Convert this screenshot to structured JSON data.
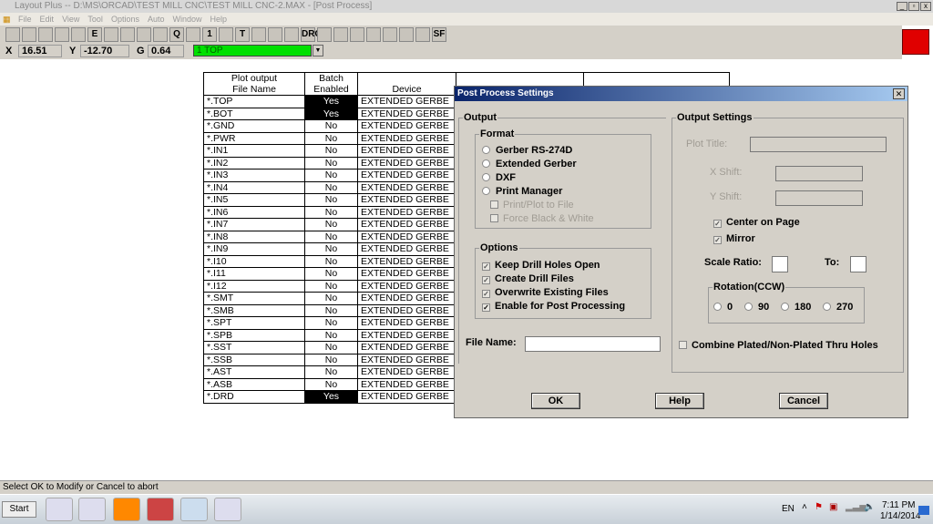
{
  "window": {
    "title": "Layout Plus -- D:\\MS\\ORCAD\\TEST MILL CNC\\TEST MILL CNC-2.MAX - [Post Process]"
  },
  "menu": [
    "File",
    "Edit",
    "View",
    "Tool",
    "Options",
    "Auto",
    "Window",
    "Help"
  ],
  "toolbar": {
    "buttons": [
      "open",
      "save",
      "stack",
      "x",
      "binoculars",
      "E",
      "grid",
      "zoom-in",
      "zoom-out",
      "zoom-window",
      "Q",
      "pad",
      "1",
      "color",
      "T",
      "route",
      "null",
      "colors",
      "DRC",
      "block",
      "swap",
      "pin",
      "gate",
      "auto",
      "error",
      "drc-check",
      "SF"
    ]
  },
  "coords": {
    "x_label": "X",
    "x": "16.51",
    "y_label": "Y",
    "y": "-12.70",
    "g_label": "G",
    "g": "0.64",
    "layer": "1 TOP"
  },
  "accent": {
    "layer_green": "#00e000",
    "red_indicator": "#e00000"
  },
  "table": {
    "headers": [
      "Plot output\nFile Name",
      "Batch\nEnabled",
      "Device"
    ],
    "header1": [
      "Plot output",
      "Batch",
      ""
    ],
    "header2": [
      "File Name",
      "Enabled",
      "Device"
    ],
    "rows": [
      [
        "*.TOP",
        "Yes",
        "EXTENDED GERBE"
      ],
      [
        "*.BOT",
        "Yes",
        "EXTENDED GERBE"
      ],
      [
        "*.GND",
        "No",
        "EXTENDED GERBE"
      ],
      [
        "*.PWR",
        "No",
        "EXTENDED GERBE"
      ],
      [
        "*.IN1",
        "No",
        "EXTENDED GERBE"
      ],
      [
        "*.IN2",
        "No",
        "EXTENDED GERBE"
      ],
      [
        "*.IN3",
        "No",
        "EXTENDED GERBE"
      ],
      [
        "*.IN4",
        "No",
        "EXTENDED GERBE"
      ],
      [
        "*.IN5",
        "No",
        "EXTENDED GERBE"
      ],
      [
        "*.IN6",
        "No",
        "EXTENDED GERBE"
      ],
      [
        "*.IN7",
        "No",
        "EXTENDED GERBE"
      ],
      [
        "*.IN8",
        "No",
        "EXTENDED GERBE"
      ],
      [
        "*.IN9",
        "No",
        "EXTENDED GERBE"
      ],
      [
        "*.I10",
        "No",
        "EXTENDED GERBE"
      ],
      [
        "*.I11",
        "No",
        "EXTENDED GERBE"
      ],
      [
        "*.I12",
        "No",
        "EXTENDED GERBE"
      ],
      [
        "*.SMT",
        "No",
        "EXTENDED GERBE"
      ],
      [
        "*.SMB",
        "No",
        "EXTENDED GERBE"
      ],
      [
        "*.SPT",
        "No",
        "EXTENDED GERBE"
      ],
      [
        "*.SPB",
        "No",
        "EXTENDED GERBE"
      ],
      [
        "*.SST",
        "No",
        "EXTENDED GERBE"
      ],
      [
        "*.SSB",
        "No",
        "EXTENDED GERBE"
      ],
      [
        "*.AST",
        "No",
        "EXTENDED GERBE"
      ],
      [
        "*.ASB",
        "No",
        "EXTENDED GERBE"
      ],
      [
        "*.DRD",
        "Yes",
        "EXTENDED GERBE"
      ]
    ]
  },
  "dialog": {
    "title": "Post Process Settings",
    "output": "Output",
    "format": "Format",
    "formats": [
      "Gerber RS-274D",
      "Extended Gerber",
      "DXF",
      "Print Manager"
    ],
    "print_to_file": "Print/Plot to File",
    "force_bw": "Force Black & White",
    "options_label": "Options",
    "options": [
      {
        "label": "Keep Drill Holes Open",
        "checked": true,
        "disabled": true
      },
      {
        "label": "Create Drill Files",
        "checked": true,
        "disabled": true
      },
      {
        "label": "Overwrite Existing Files",
        "checked": true,
        "disabled": true
      },
      {
        "label": "Enable for Post Processing",
        "checked": true,
        "disabled": false
      }
    ],
    "file_name_label": "File Name:",
    "file_name": "",
    "output_settings": "Output Settings",
    "plot_title": "Plot Title:",
    "x_shift": "X Shift:",
    "y_shift": "Y Shift:",
    "center_on_page": "Center on Page",
    "mirror": "Mirror",
    "scale_ratio": "Scale Ratio:",
    "to": "To:",
    "rotation": "Rotation(CCW)",
    "rotations": [
      "0",
      "90",
      "180",
      "270"
    ],
    "combine": "Combine Plated/Non-Plated Thru Holes",
    "ok": "OK",
    "help": "Help",
    "cancel": "Cancel"
  },
  "status": "Select OK to Modify or Cancel to abort",
  "taskbar": {
    "start": "Start",
    "lang": "EN",
    "time": "7:11 PM",
    "date": "1/14/2014"
  }
}
